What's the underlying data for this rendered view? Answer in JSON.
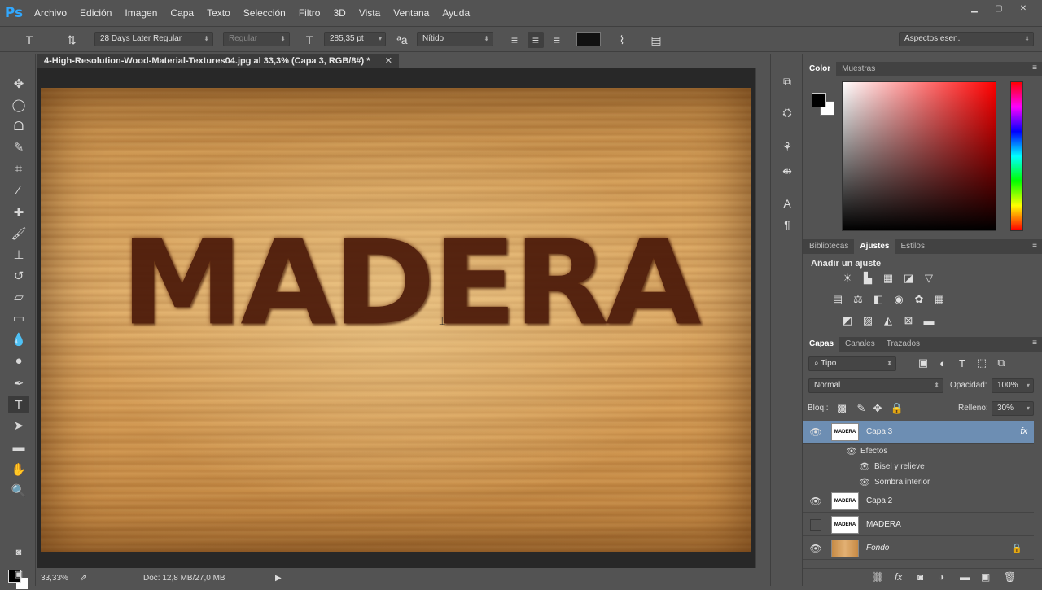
{
  "app": {
    "logo": "Ps"
  },
  "menu": [
    "Archivo",
    "Edición",
    "Imagen",
    "Capa",
    "Texto",
    "Selección",
    "Filtro",
    "3D",
    "Vista",
    "Ventana",
    "Ayuda"
  ],
  "options": {
    "font_family": "28 Days Later Regular",
    "font_style": "Regular",
    "font_size": "285,35 pt",
    "antialias": "Nítido",
    "workspace": "Aspectos esen."
  },
  "document": {
    "tab_title": "4-High-Resolution-Wood-Material-Textures04.jpg al 33,3% (Capa 3, RGB/8#) *",
    "canvas_text": "MADERA",
    "zoom": "33,33%",
    "doc_info": "Doc: 12,8 MB/27,0 MB"
  },
  "color_panel": {
    "tabs": [
      "Color",
      "Muestras"
    ],
    "fg": "#000000",
    "bg": "#ffffff"
  },
  "adjust_panel": {
    "tabs": [
      "Bibliotecas",
      "Ajustes",
      "Estilos"
    ],
    "title": "Añadir un ajuste"
  },
  "layers_panel": {
    "tabs": [
      "Capas",
      "Canales",
      "Trazados"
    ],
    "filter": "Tipo",
    "blend_mode": "Normal",
    "opacity_label": "Opacidad:",
    "opacity": "100%",
    "lock_label": "Bloq.:",
    "fill_label": "Relleno:",
    "fill": "30%",
    "effects_label": "Efectos",
    "effects": [
      "Bisel y relieve",
      "Sombra interior"
    ],
    "layers": [
      {
        "name": "Capa 3",
        "thumb_text": "MADERA",
        "fx": "fx"
      },
      {
        "name": "Capa 2",
        "thumb_text": "MADERA"
      },
      {
        "name": "MADERA",
        "thumb_text": "MADERA"
      },
      {
        "name": "Fondo"
      }
    ]
  }
}
